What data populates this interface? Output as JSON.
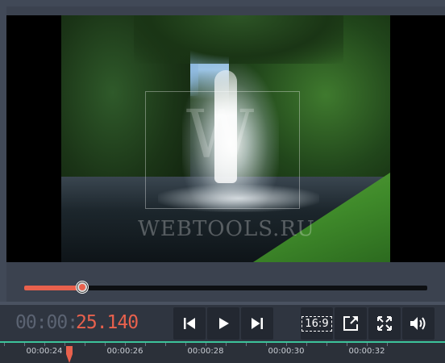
{
  "preview": {
    "watermark_letter": "W",
    "watermark_text": "WEBTOOLS.RU"
  },
  "progress": {
    "fraction": 0.143
  },
  "timecode": {
    "dim": "00:00:",
    "lit": "25.140"
  },
  "buttons": {
    "previous": "skip-back-icon",
    "play": "play-icon",
    "next": "skip-forward-icon",
    "aspect_ratio": "16:9",
    "export": "open-external-icon",
    "fullscreen": "fullscreen-icon",
    "volume": "volume-icon"
  },
  "timeline": {
    "ticks": [
      "00:00:24",
      "00:00:26",
      "00:00:28",
      "00:00:30",
      "00:00:32"
    ],
    "playhead_color": "#e8614d",
    "accent_line_color": "#3cc39a"
  },
  "colors": {
    "accent": "#e8614d",
    "background": "#3b424f"
  }
}
